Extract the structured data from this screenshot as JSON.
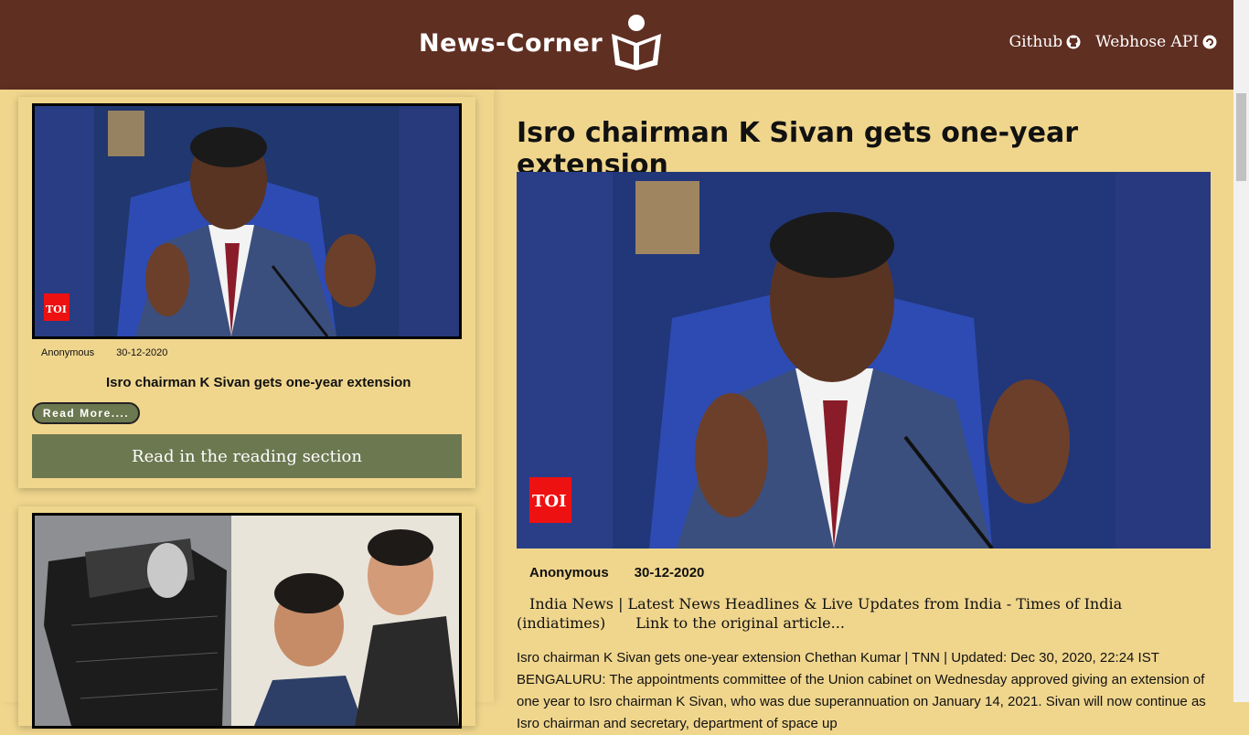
{
  "header": {
    "brand": "News-Corner",
    "nav": [
      {
        "label": "Github",
        "icon": "github-icon"
      },
      {
        "label": "Webhose API",
        "icon": "webhose-icon"
      }
    ],
    "colors": {
      "bar": "#5f2f22",
      "page": "#f0d68d",
      "button": "#6c7850"
    }
  },
  "cards": [
    {
      "author": "Anonymous",
      "date": "30-12-2020",
      "title": "Isro chairman K Sivan gets one-year extension",
      "read_more": "Read More....",
      "read_section": "Read in the reading section",
      "image_logo": "TOI"
    },
    {
      "image": "satellite-and-students-photo"
    }
  ],
  "article": {
    "title": "Isro chairman K Sivan gets one-year extension",
    "image_logo": "TOI",
    "author": "Anonymous",
    "date": "30-12-2020",
    "source": "India News | Latest News Headlines & Live Updates from India - Times of India (indiatimes)",
    "link": "Link to the original article...",
    "body": "Isro chairman K Sivan gets one-year extension Chethan Kumar | TNN | Updated: Dec 30, 2020, 22:24 IST BENGALURU: The appointments committee of the Union cabinet on Wednesday approved giving an extension of one year to Isro chairman K Sivan, who was due superannuation on January 14, 2021. Sivan will now continue as Isro chairman and secretary, department of space up"
  }
}
